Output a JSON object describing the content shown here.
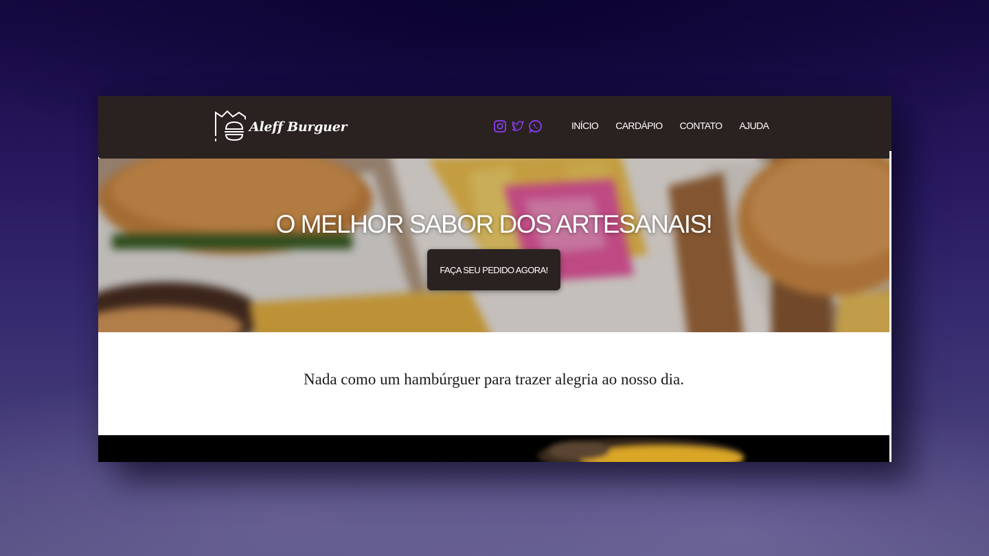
{
  "brand": {
    "name": "Aleff Burguer"
  },
  "socials": [
    {
      "icon": "instagram-icon",
      "color": "#8b3cf7"
    },
    {
      "icon": "twitter-icon",
      "color": "#8b3cf7"
    },
    {
      "icon": "whatsapp-icon",
      "color": "#8b3cf7"
    }
  ],
  "nav": {
    "items": [
      {
        "label": "INÍCIO"
      },
      {
        "label": "CARDÁPIO"
      },
      {
        "label": "CONTATO"
      },
      {
        "label": "AJUDA"
      }
    ]
  },
  "hero": {
    "title": "O MELHOR SABOR DOS ARTESANAIS!",
    "cta_label": "FAÇA SEU PEDIDO AGORA!"
  },
  "intro": {
    "text": "Nada como um hambúrguer para trazer alegria ao nosso dia."
  },
  "colors": {
    "navbar": "#2a2220",
    "accent": "#8b3cf7",
    "page_bg": "#1f1150"
  }
}
